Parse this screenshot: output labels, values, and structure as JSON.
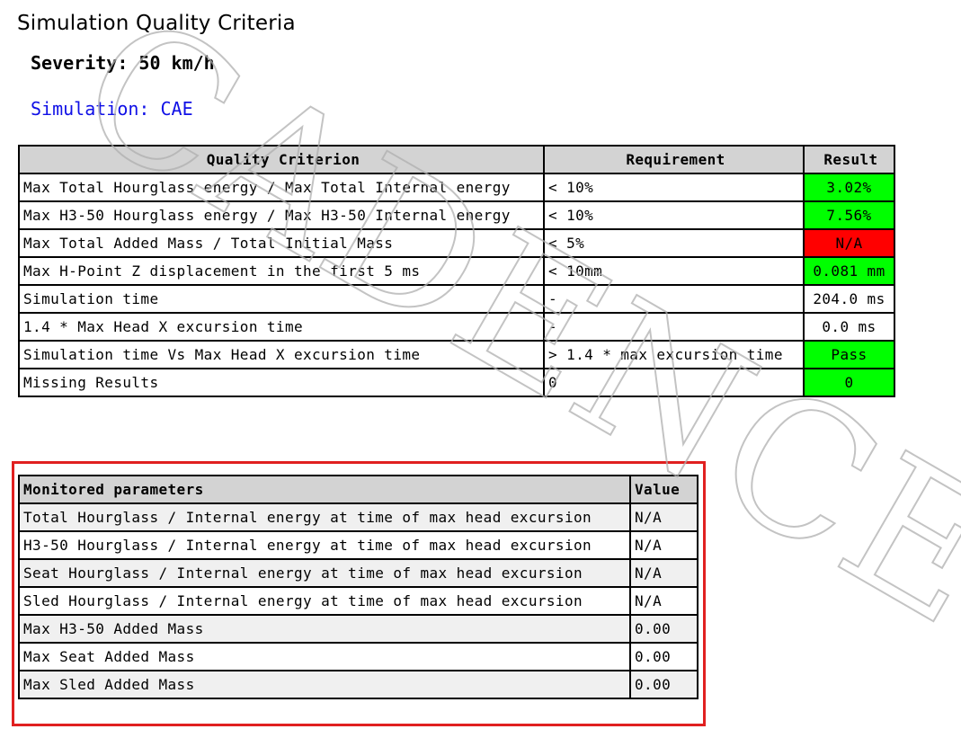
{
  "page": {
    "title": "Simulation Quality Criteria",
    "severity": "Severity: 50 km/h",
    "simulation": "Simulation: CAE",
    "watermark": "CADENCE"
  },
  "quality": {
    "headers": [
      "Quality Criterion",
      "Requirement",
      "Result"
    ],
    "rows": [
      {
        "criterion": "Max Total Hourglass energy / Max Total Internal energy",
        "requirement": "< 10%",
        "result": "3.02%",
        "status": "pass"
      },
      {
        "criterion": "Max H3-50 Hourglass energy / Max H3-50 Internal energy",
        "requirement": "< 10%",
        "result": "7.56%",
        "status": "pass"
      },
      {
        "criterion": "Max Total Added Mass / Total Initial Mass",
        "requirement": "< 5%",
        "result": "N/A",
        "status": "fail"
      },
      {
        "criterion": "Max H-Point Z displacement in the first 5 ms",
        "requirement": "< 10mm",
        "result": "0.081 mm",
        "status": "pass"
      },
      {
        "criterion": "Simulation time",
        "requirement": "-",
        "result": "204.0 ms",
        "status": "none"
      },
      {
        "criterion": "1.4 * Max Head X excursion time",
        "requirement": "-",
        "result": "0.0 ms",
        "status": "none"
      },
      {
        "criterion": "Simulation time Vs Max Head X excursion time",
        "requirement": "> 1.4 * max excursion time",
        "result": "Pass",
        "status": "pass"
      },
      {
        "criterion": "Missing Results",
        "requirement": "0",
        "result": "0",
        "status": "pass"
      }
    ]
  },
  "monitored": {
    "headers": [
      "Monitored parameters",
      "Value"
    ],
    "rows": [
      {
        "parameter": "Total Hourglass / Internal energy at time of max head excursion",
        "value": "N/A"
      },
      {
        "parameter": "H3-50 Hourglass / Internal energy at time of max head excursion",
        "value": "N/A"
      },
      {
        "parameter": "Seat Hourglass / Internal energy at time of max head excursion",
        "value": "N/A"
      },
      {
        "parameter": "Sled Hourglass / Internal energy at time of max head excursion",
        "value": "N/A"
      },
      {
        "parameter": "Max H3-50 Added Mass",
        "value": "0.00"
      },
      {
        "parameter": "Max Seat Added Mass",
        "value": "0.00"
      },
      {
        "parameter": "Max Sled Added Mass",
        "value": "0.00"
      }
    ]
  },
  "colors": {
    "pass": "#00ff00",
    "fail": "#ff0000",
    "header_bg": "#d3d3d3",
    "simulation_text": "#1010e6",
    "highlight_frame": "#e02020"
  }
}
